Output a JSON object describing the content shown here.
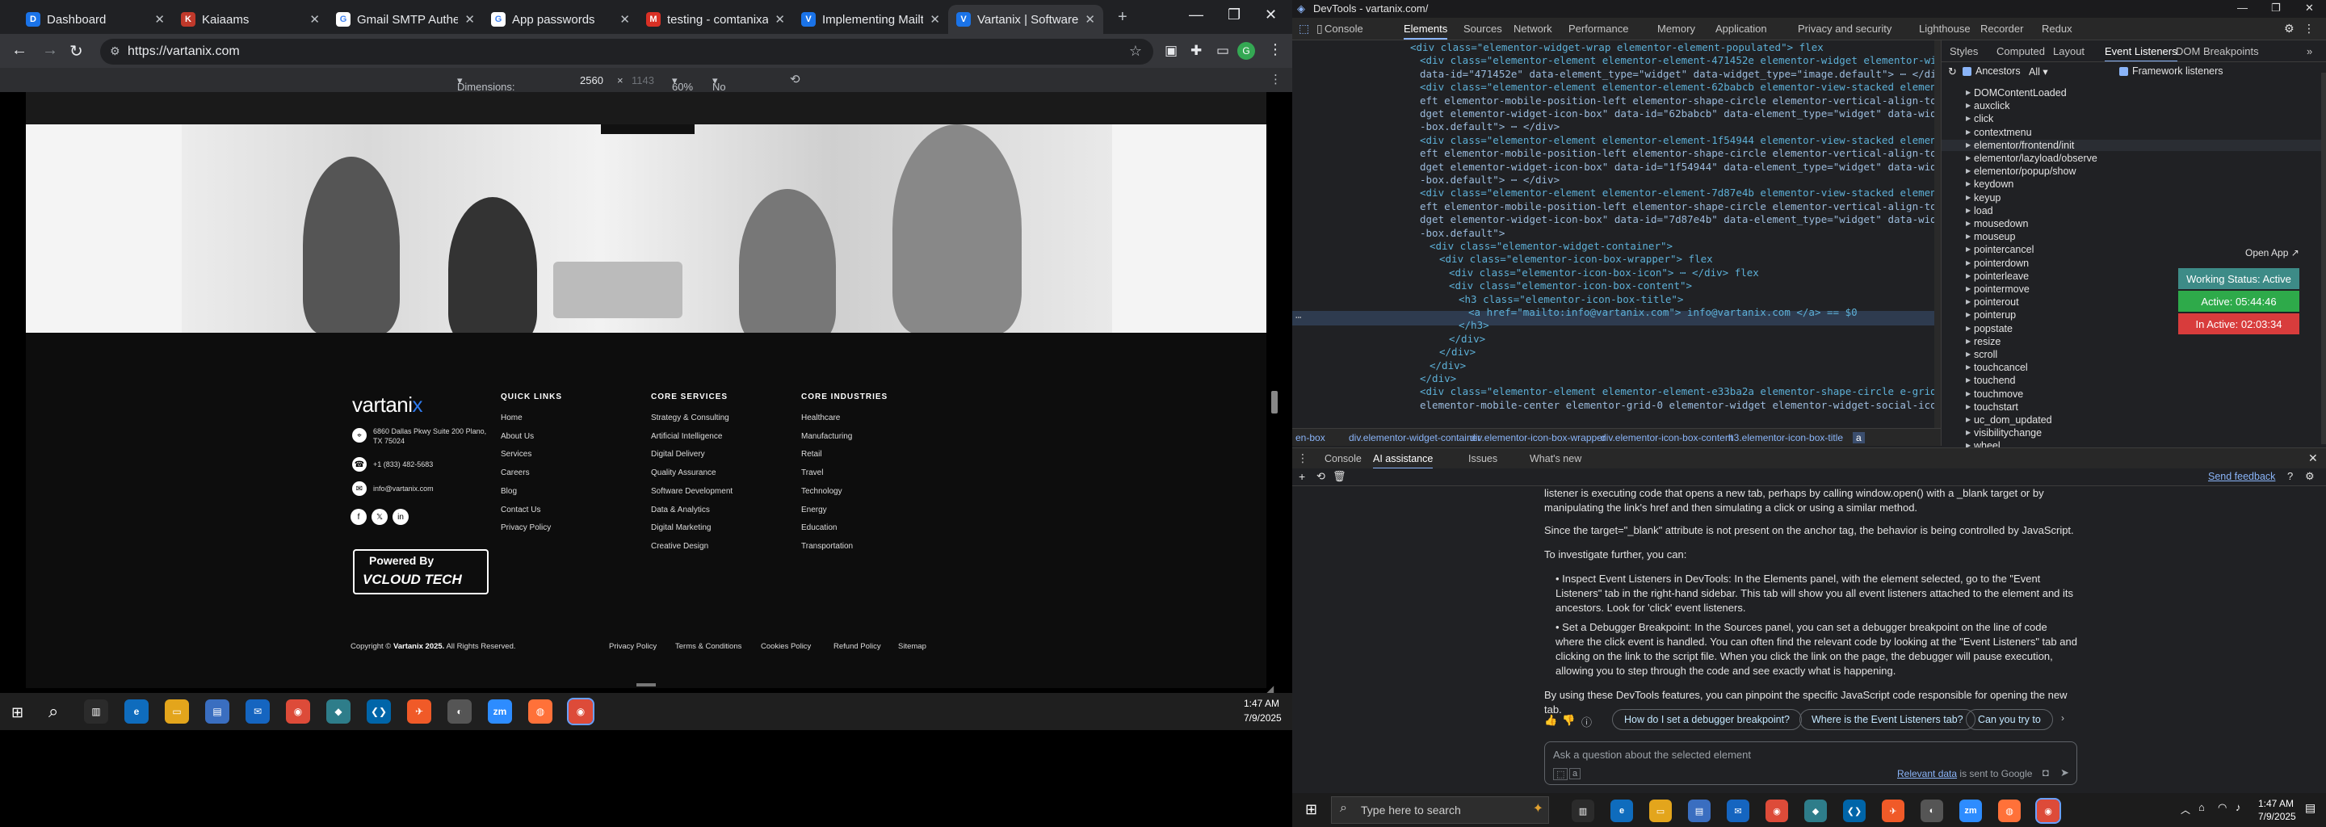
{
  "browser": {
    "tabs": [
      {
        "title": "Dashboard",
        "fav": "D",
        "color": "#1a73e8"
      },
      {
        "title": "Kaiaams",
        "fav": "K",
        "color": "#c0392b"
      },
      {
        "title": "Gmail SMTP Authentic",
        "fav": "G",
        "color": "#ffffff"
      },
      {
        "title": "App passwords",
        "fav": "G",
        "color": "#ffffff"
      },
      {
        "title": "testing - comtanixahs",
        "fav": "M",
        "color": "#d93025"
      },
      {
        "title": "Implementing Mailto",
        "fav": "V",
        "color": "#1a73e8"
      },
      {
        "title": "Vartanix | Software De",
        "fav": "V",
        "color": "#1a73e8"
      }
    ],
    "url": "https://vartanix.com",
    "device_toolbar": {
      "dimensions": "Dimensions: Responsive",
      "width": "2560",
      "times": "×",
      "height": "1143",
      "zoom": "60%",
      "throttling": "No throttling"
    }
  },
  "website": {
    "logo": "vartani",
    "logo_accent": "x",
    "address": "6860 Dallas Pkwy Suite 200 Plano, TX 75024",
    "phone": "+1 (833) 482-5683",
    "email": "info@vartanix.com",
    "social": [
      "f",
      "𝕏",
      "in"
    ],
    "powered_by": "Powered By",
    "powered_brand": "VCLOUD TECH",
    "columns": [
      {
        "heading": "QUICK LINKS",
        "items": [
          "Home",
          "About Us",
          "Services",
          "Careers",
          "Blog",
          "Contact Us",
          "Privacy Policy"
        ]
      },
      {
        "heading": "CORE SERVICES",
        "items": [
          "Strategy & Consulting",
          "Artificial Intelligence",
          "Digital Delivery",
          "Quality Assurance",
          "Software Development",
          "Data & Analytics",
          "Digital Marketing",
          "Creative Design"
        ]
      },
      {
        "heading": "CORE INDUSTRIES",
        "items": [
          "Healthcare",
          "Manufacturing",
          "Retail",
          "Travel",
          "Technology",
          "Energy",
          "Education",
          "Transportation"
        ]
      }
    ],
    "copyright_pre": "Copyright © ",
    "copyright_brand": "Vartanix 2025.",
    "copyright_post": " All Rights Reserved.",
    "bottom_links": [
      "Privacy Policy",
      "Terms & Conditions",
      "Cookies Policy",
      "Refund Policy",
      "Sitemap"
    ]
  },
  "taskbar_left": {
    "time": "1:47 AM",
    "date": "7/9/2025"
  },
  "devtools": {
    "title": "DevTools - vartanix.com/",
    "tabs": [
      "Console",
      "Elements",
      "Sources",
      "Network",
      "Performance",
      "Memory",
      "Application",
      "Privacy and security",
      "Lighthouse",
      "Recorder",
      "Redux"
    ],
    "elements_lines": [
      "<div class=\"elementor-widget-wrap elementor-element-populated\"> flex",
      "<div class=\"elementor-element elementor-element-471452e elementor-widget elementor-widget-image\"",
      "data-id=\"471452e\" data-element_type=\"widget\" data-widget_type=\"image.default\"> ⋯ </div>",
      "<div class=\"elementor-element elementor-element-62babcb elementor-view-stacked elementor-position-l",
      "eft elementor-mobile-position-left elementor-shape-circle elementor-vertical-align-top elementor-wi",
      "dget elementor-widget-icon-box\" data-id=\"62babcb\" data-element_type=\"widget\" data-widget_type=\"icon",
      "-box.default\"> ⋯ </div>",
      "<div class=\"elementor-element elementor-element-1f54944 elementor-view-stacked elementor-position-l",
      "eft elementor-mobile-position-left elementor-shape-circle elementor-vertical-align-top elementor-wi",
      "dget elementor-widget-icon-box\" data-id=\"1f54944\" data-element_type=\"widget\" data-widget_type=\"icon",
      "-box.default\"> ⋯ </div>",
      "<div class=\"elementor-element elementor-element-7d87e4b elementor-view-stacked elementor-position-l",
      "eft elementor-mobile-position-left elementor-shape-circle elementor-vertical-align-top elementor-wi",
      "dget elementor-widget-icon-box\" data-id=\"7d87e4b\" data-element_type=\"widget\" data-widget_type=\"icon",
      "-box.default\">",
      "<div class=\"elementor-widget-container\">",
      "<div class=\"elementor-icon-box-wrapper\"> flex",
      "<div class=\"elementor-icon-box-icon\"> ⋯ </div> flex",
      "<div class=\"elementor-icon-box-content\">",
      "<h3 class=\"elementor-icon-box-title\">",
      "<a href=\"mailto:info@vartanix.com\"> info@vartanix.com </a> == $0",
      "</h3>",
      "</div>",
      "</div>",
      "</div>",
      "</div>",
      "<div class=\"elementor-element elementor-element-e33ba2a elementor-shape-circle e-grid-align-left e-",
      "elementor-mobile-center elementor-grid-0 elementor-widget elementor-widget-social-icons\" data-id"
    ],
    "breadcrumbs": [
      "en-box",
      "div.elementor-widget-container",
      "div.elementor-icon-box-wrapper",
      "div.elementor-icon-box-content",
      "h3.elementor-icon-box-title",
      "a"
    ],
    "side_tabs": [
      "Styles",
      "Computed",
      "Layout",
      "Event Listeners",
      "DOM Breakpoints"
    ],
    "filter_ancestors": "Ancestors",
    "filter_all": "All",
    "filter_framework": "Framework listeners",
    "events": [
      "DOMContentLoaded",
      "auxclick",
      "click",
      "contextmenu",
      "elementor/frontend/init",
      "elementor/lazyload/observe",
      "elementor/popup/show",
      "keydown",
      "keyup",
      "load",
      "mousedown",
      "mouseup",
      "pointercancel",
      "pointerdown",
      "pointerleave",
      "pointermove",
      "pointerout",
      "pointerup",
      "popstate",
      "resize",
      "scroll",
      "touchcancel",
      "touchend",
      "touchmove",
      "touchstart",
      "uc_dom_updated",
      "visibilitychange",
      "wheel"
    ],
    "open_app": "Open App",
    "working_status": "Working Status: Active",
    "active_time": "Active: 05:44:46",
    "inactive_time": "In Active: 02:03:34",
    "drawer_tabs": [
      "Console",
      "AI assistance",
      "Issues",
      "What's new"
    ],
    "send_feedback": "Send feedback",
    "ai_paragraphs": [
      "listener is executing code that opens a new tab, perhaps by calling window.open() with a _blank target or by manipulating the link's href and then simulating a click or using a similar method.",
      "Since the target=\"_blank\" attribute is not present on the anchor tag, the behavior is being controlled by JavaScript.",
      "To investigate further, you can:",
      "Inspect Event Listeners in DevTools: In the Elements panel, with the element selected, go to the \"Event Listeners\" tab in the right-hand sidebar. This tab will show you all event listeners attached to the element and its ancestors. Look for 'click' event listeners.",
      "Set a Debugger Breakpoint: In the Sources panel, you can set a debugger breakpoint on the line of code where the click event is handled. You can often find the relevant code by looking at the \"Event Listeners\" tab and clicking on the link to the script file. When you click the link on the page, the debugger will pause execution, allowing you to step through the code and see exactly what is happening.",
      "By using these DevTools features, you can pinpoint the specific JavaScript code responsible for opening the new tab."
    ],
    "suggestions": [
      "How do I set a debugger breakpoint?",
      "Where is the Event Listeners tab?",
      "Can you try to"
    ],
    "ask_placeholder": "Ask a question about the selected element",
    "relevant_data": "Relevant data",
    "sent_to_google": " is sent to Google"
  },
  "windows_taskbar": {
    "search_placeholder": "Type here to search",
    "time": "1:47 AM",
    "date": "7/9/2025"
  }
}
